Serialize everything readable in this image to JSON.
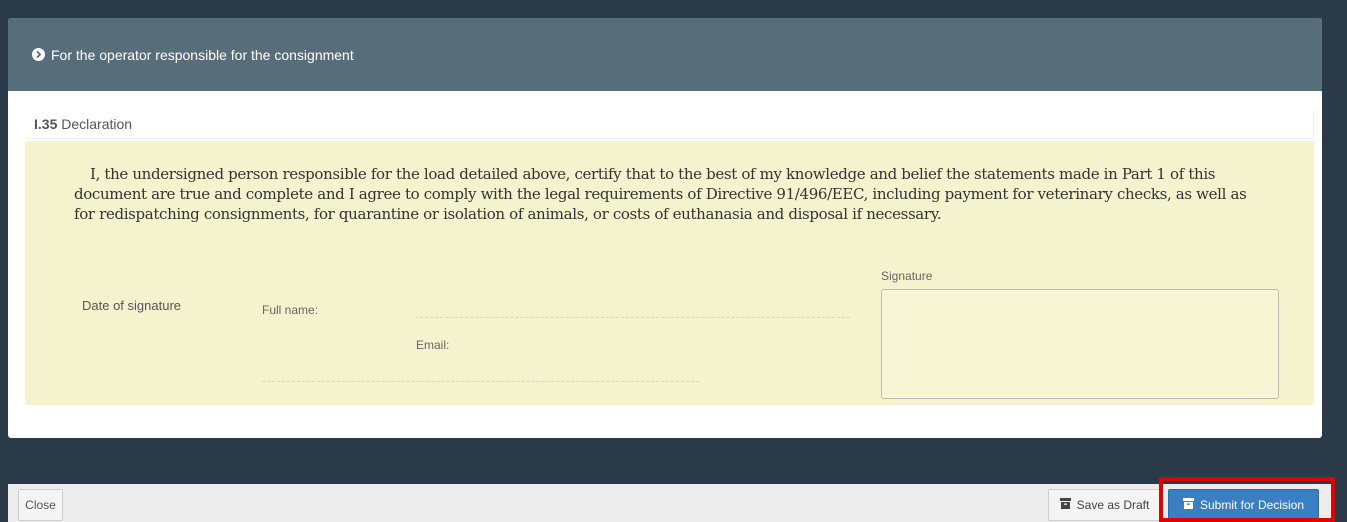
{
  "modal": {
    "header_title": "For the operator responsible for the consignment",
    "section": {
      "code": "I.35",
      "title": "Declaration"
    },
    "declaration_text": "I, the undersigned person responsible for the load detailed above, certify that to the best of my knowledge and belief the statements made in Part 1 of this document are true and complete and I agree to comply with the legal requirements of Directive 91/496/EEC, including payment for veterinary checks, as well as for redispatching consignments, for quarantine or isolation of animals, or costs of euthanasia and disposal if necessary.",
    "fields": {
      "date_of_signature_label": "Date of signature",
      "full_name_label": "Full name:",
      "full_name_value": "",
      "email_label": "Email:",
      "email_value": "",
      "signature_label": "Signature"
    }
  },
  "footer": {
    "close_label": "Close",
    "save_draft_label": "Save as Draft",
    "submit_label": "Submit for Decision"
  },
  "colors": {
    "header_bg": "#586d7a",
    "declaration_bg": "#f5f3ce",
    "submit_bg": "#3a7fc3",
    "highlight": "#e00000"
  },
  "icons": {
    "header": "chevron-circle-right-icon",
    "save_draft": "archive-icon",
    "submit": "archive-icon"
  }
}
